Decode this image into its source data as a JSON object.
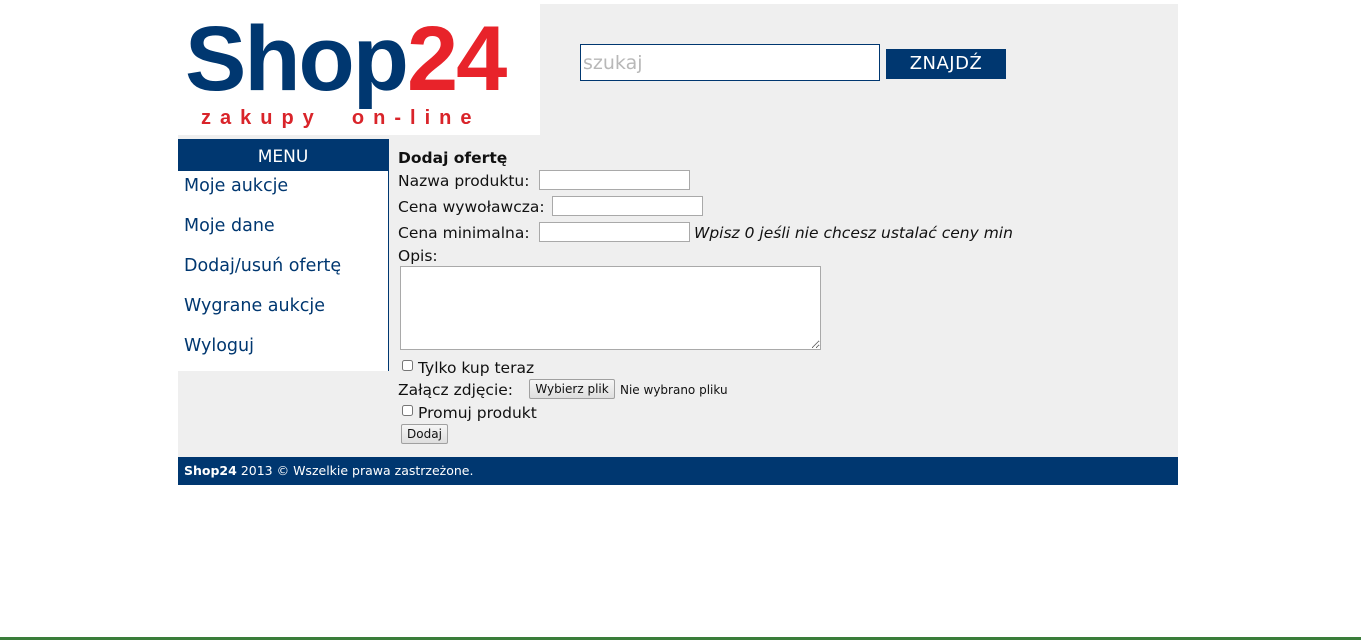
{
  "logo": {
    "brand_part1": "Shop",
    "brand_part2": "24",
    "tagline": "zakupy  on-line",
    "colors": {
      "navy": "#003770",
      "red": "#e8232a"
    }
  },
  "search": {
    "placeholder": "szukaj",
    "value": "",
    "button_label": "ZNAJDŹ"
  },
  "menu": {
    "header": "MENU",
    "items": [
      {
        "label": "Moje aukcje"
      },
      {
        "label": "Moje dane"
      },
      {
        "label": "Dodaj/usuń ofertę"
      },
      {
        "label": "Wygrane aukcje"
      },
      {
        "label": "Wyloguj"
      }
    ]
  },
  "form": {
    "title": "Dodaj ofertę",
    "product_name_label": "Nazwa produktu:",
    "product_name_value": "",
    "start_price_label": "Cena wywoławcza:",
    "start_price_value": "",
    "min_price_label": "Cena minimalna:",
    "min_price_value": "",
    "min_price_hint": "Wpisz 0 jeśli nie chcesz ustalać ceny min",
    "description_label": "Opis:",
    "description_value": "",
    "buy_now_label": "Tylko kup teraz",
    "buy_now_checked": false,
    "photo_label": "Załącz zdjęcie:",
    "photo_button": "Wybierz plik",
    "photo_status": "Nie wybrano pliku",
    "promote_label": "Promuj produkt",
    "promote_checked": false,
    "submit_label": "Dodaj"
  },
  "footer": {
    "brand": "Shop24",
    "text": " 2013 © Wszelkie prawa zastrzeżone."
  }
}
